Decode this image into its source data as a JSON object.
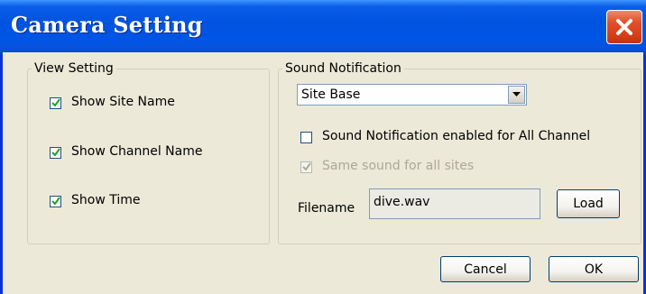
{
  "window": {
    "title": "Camera Setting"
  },
  "view_setting": {
    "legend": "View Setting",
    "items": [
      {
        "label": "Show Site Name",
        "checked": true
      },
      {
        "label": "Show Channel Name",
        "checked": true
      },
      {
        "label": "Show Time",
        "checked": true
      }
    ]
  },
  "sound_notification": {
    "legend": "Sound Notification",
    "mode_select": {
      "value": "Site Base"
    },
    "enable_all": {
      "label": "Sound Notification enabled for All Channel",
      "checked": false
    },
    "same_sound": {
      "label": "Same sound for all sites",
      "checked": true,
      "disabled": true
    },
    "filename": {
      "label": "Filename",
      "value": "dive.wav"
    },
    "load_label": "Load"
  },
  "footer": {
    "cancel_label": "Cancel",
    "ok_label": "OK"
  },
  "colors": {
    "titlebar": "#0053e0",
    "close": "#d8401c",
    "dialog_bg": "#ece9d8"
  }
}
